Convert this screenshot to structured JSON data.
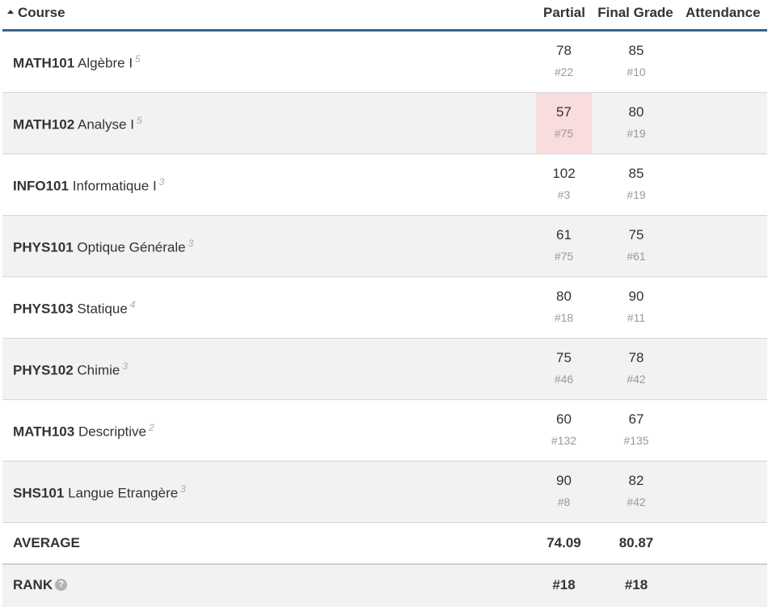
{
  "header": {
    "course": "Course",
    "partial": "Partial",
    "final": "Final Grade",
    "attendance": "Attendance"
  },
  "courses": [
    {
      "code": "MATH101",
      "name": "Algèbre I",
      "credits": "5",
      "partial": "78",
      "partial_rank": "#22",
      "final": "85",
      "final_rank": "#10"
    },
    {
      "code": "MATH102",
      "name": "Analyse I",
      "credits": "5",
      "partial": "57",
      "partial_rank": "#75",
      "final": "80",
      "final_rank": "#19"
    },
    {
      "code": "INFO101",
      "name": "Informatique I",
      "credits": "3",
      "partial": "102",
      "partial_rank": "#3",
      "final": "85",
      "final_rank": "#19"
    },
    {
      "code": "PHYS101",
      "name": "Optique Générale",
      "credits": "3",
      "partial": "61",
      "partial_rank": "#75",
      "final": "75",
      "final_rank": "#61"
    },
    {
      "code": "PHYS103",
      "name": "Statique",
      "credits": "4",
      "partial": "80",
      "partial_rank": "#18",
      "final": "90",
      "final_rank": "#11"
    },
    {
      "code": "PHYS102",
      "name": "Chimie",
      "credits": "3",
      "partial": "75",
      "partial_rank": "#46",
      "final": "78",
      "final_rank": "#42"
    },
    {
      "code": "MATH103",
      "name": "Descriptive",
      "credits": "2",
      "partial": "60",
      "partial_rank": "#132",
      "final": "67",
      "final_rank": "#135"
    },
    {
      "code": "SHS101",
      "name": "Langue Etrangère",
      "credits": "3",
      "partial": "90",
      "partial_rank": "#8",
      "final": "82",
      "final_rank": "#42"
    }
  ],
  "average": {
    "label": "AVERAGE",
    "partial": "74.09",
    "final": "80.87"
  },
  "rank": {
    "label": "RANK",
    "partial": "#18",
    "final": "#18",
    "help_icon": "question-circle-icon"
  },
  "colors": {
    "header_border": "#34648f",
    "low_grade_bg": "#f9dcdc",
    "stripe": "#f2f2f2"
  }
}
